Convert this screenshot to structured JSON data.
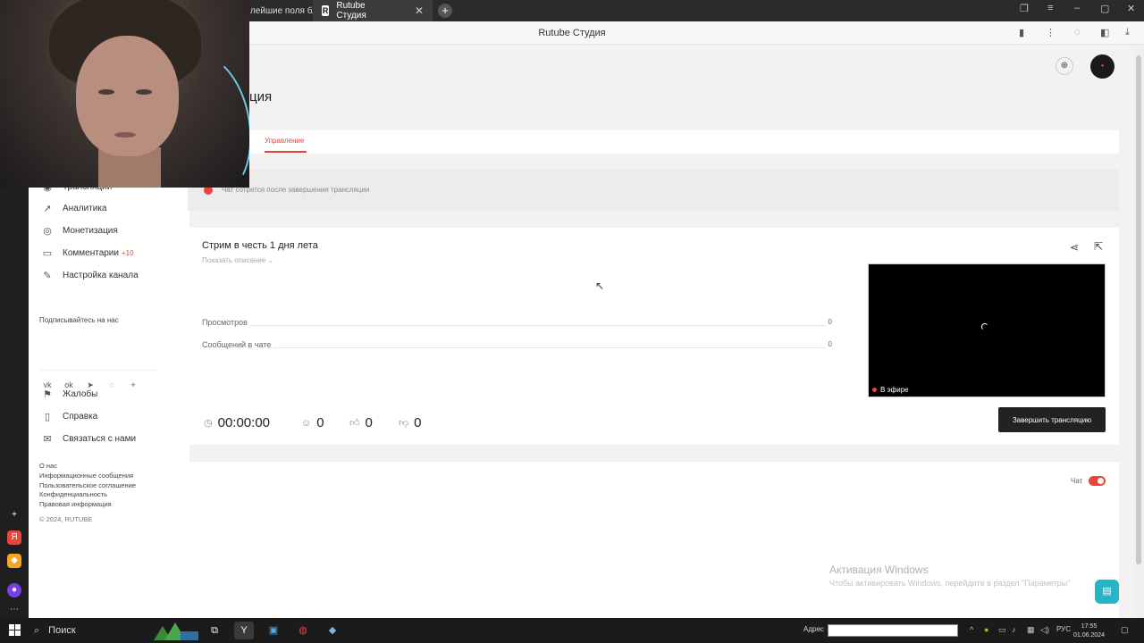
{
  "browser": {
    "tabs": [
      {
        "label": "лейшие поля бл"
      },
      {
        "label": "Rutube Студия",
        "logo": "R"
      }
    ],
    "page_title": "Rutube Студия"
  },
  "sidebar": {
    "items": [
      {
        "label": "Трансляции",
        "icon": "broadcast-icon"
      },
      {
        "label": "Аналитика",
        "icon": "chart-icon"
      },
      {
        "label": "Монетизация",
        "icon": "coin-icon"
      },
      {
        "label": "Комментарии",
        "badge": "+10",
        "icon": "comment-icon"
      },
      {
        "label": "Настройка канала",
        "icon": "settings-icon"
      }
    ],
    "subscribe_label": "Подписывайтесь на нас",
    "social": [
      "VK",
      "OK",
      "Telegram",
      "Viber",
      "+"
    ],
    "help_items": [
      {
        "label": "Жалобы"
      },
      {
        "label": "Справка"
      },
      {
        "label": "Связаться с нами"
      }
    ],
    "footer_links": [
      "О нас",
      "Информационные сообщения",
      "Пользовательское соглашение",
      "Конфиденциальность",
      "Правовая информация"
    ],
    "copyright": "© 2024, RUTUBE"
  },
  "main": {
    "heading": "ция",
    "tab_manage": "Управление",
    "notice": "Чат сотрется после завершения трансляции",
    "stream": {
      "title": "Стрим в честь 1 дня лета",
      "show_description": "Показать описание ⌄",
      "stats": [
        {
          "label": "Просмотров",
          "value": "0"
        },
        {
          "label": "Сообщений в чате",
          "value": "0"
        }
      ],
      "metrics": {
        "duration": "00:00:00",
        "viewers": "0",
        "likes": "0",
        "dislikes": "0"
      },
      "live_label": "В эфире",
      "end_button": "Завершить трансляцию"
    },
    "chat_label": "Чат"
  },
  "windows": {
    "activation_title": "Активация Windows",
    "activation_sub": "Чтобы активировать Windows, перейдите в раздел \"Параметры\"",
    "search_label": "Поиск",
    "addr_label": "Адрес",
    "lang": "РУС",
    "time": "17:55",
    "date": "01.06.2024"
  },
  "colors": {
    "accent": "#e8453c",
    "support": "#26b5c6"
  }
}
